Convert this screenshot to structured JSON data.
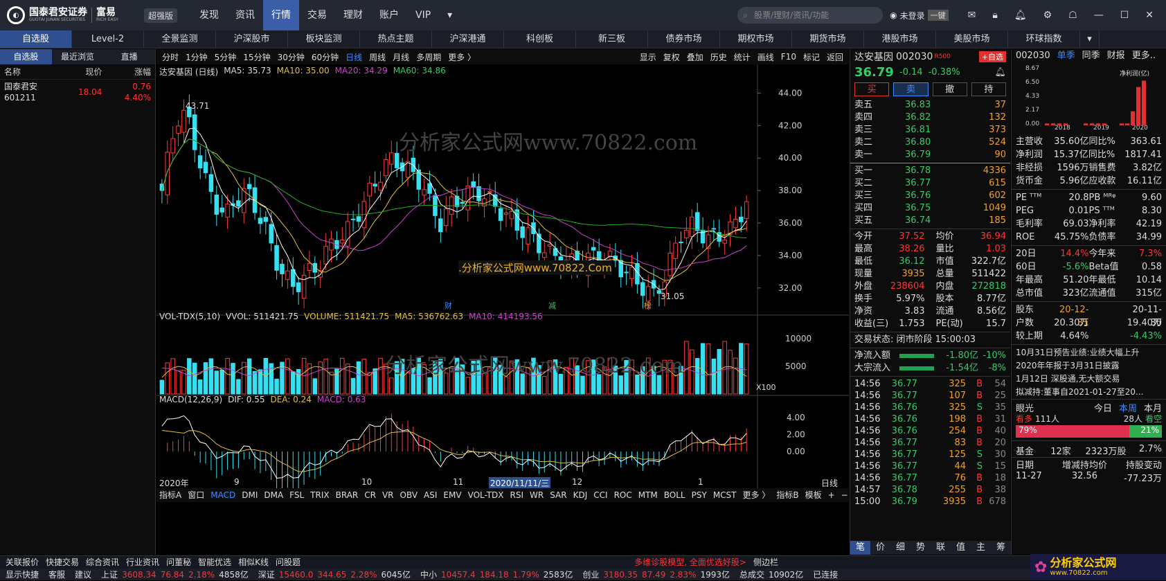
{
  "app": {
    "logo_text": "国泰君安证券",
    "logo_sub": "GUOTAI JUNAN SECURITIES",
    "brand": "富易",
    "brand_sub": "RICH EASY",
    "version": "超强版"
  },
  "nav": {
    "items": [
      "发现",
      "资讯",
      "行情",
      "交易",
      "理财",
      "账户",
      "VIP"
    ],
    "active": "行情",
    "search_placeholder": "股票/理财/资讯/功能",
    "login": "未登录",
    "theme": "一键"
  },
  "tabs": [
    "自选股",
    "Level-2",
    "全景监测",
    "沪深股市",
    "板块监测",
    "热点主题",
    "沪深港通",
    "科创板",
    "新三板",
    "债券市场",
    "期权市场",
    "期货市场",
    "港股市场",
    "美股市场",
    "环球指数"
  ],
  "left": {
    "tabs": [
      "自选股",
      "最近浏览",
      "直播"
    ],
    "cols": [
      "名称",
      "现价",
      "涨幅"
    ],
    "rows": [
      {
        "name": "国泰君安",
        "code": "601211",
        "price": "18.04",
        "chg": "0.76",
        "pct": "4.40%"
      }
    ]
  },
  "chart": {
    "periods": [
      "分时",
      "1分钟",
      "5分钟",
      "15分钟",
      "30分钟",
      "60分钟",
      "日线",
      "周线",
      "月线",
      "多周期",
      "更多 〉"
    ],
    "active_period": "日线",
    "tools": [
      "显示",
      "复权",
      "叠加",
      "历史",
      "统计",
      "画线",
      "F10",
      "标记",
      "返回"
    ],
    "title": "达安基因 (日线)",
    "ma5": "MA5: 35.73",
    "ma10": "MA10: 35.00",
    "ma20": "MA20: 34.29",
    "ma60": "MA60: 34.86",
    "high_label": "43.71",
    "low_label": "31.05",
    "vol_title": "VOL-TDX(5,10)",
    "vvol": "VVOL: 511421.75",
    "volume": "VOLUME: 511421.75",
    "vma5": "MA5: 536762.63",
    "vma10": "MA10: 414193.56",
    "vol_unit": "X100",
    "macd_title": "MACD(12,26,9)",
    "dif": "DIF: 0.55",
    "dea": "DEA: 0.24",
    "macd": "MACD: 0.63",
    "date_labels": [
      "2020年",
      "9",
      "10",
      "11",
      "2020/11/11/三",
      "12",
      "1",
      "日线"
    ],
    "markers": [
      "财",
      "减",
      "榜"
    ],
    "bottom_tabs": [
      "指标A",
      "窗口",
      "MACD",
      "DMI",
      "DMA",
      "FSL",
      "TRIX",
      "BRAR",
      "CR",
      "VR",
      "OBV",
      "ASI",
      "EMV",
      "VOL-TDX",
      "RSI",
      "WR",
      "SAR",
      "KDJ",
      "CCI",
      "ROC",
      "MTM",
      "BOLL",
      "PSY",
      "MCST",
      "更多 〉",
      "指标B",
      "模板",
      "+",
      "−"
    ],
    "watermark1": "分析家公式网www.70822.com",
    "watermark2": ".分析家公式网www.70822.Com"
  },
  "chart_data": {
    "type": "candlestick",
    "price_ticks": [
      44,
      42,
      40,
      38,
      36,
      34,
      32
    ],
    "vol_ticks": [
      10000,
      5000
    ],
    "macd_ticks": [
      4,
      2,
      0
    ],
    "close_series": [
      38,
      41,
      43,
      42,
      40,
      38,
      37,
      36.5,
      37.5,
      38,
      37,
      36,
      34,
      33,
      32,
      32.5,
      33,
      33.5,
      34.5,
      35,
      35.5,
      36.5,
      37.5,
      38.5,
      39.5,
      40,
      39.5,
      39,
      38.5,
      37,
      36,
      37,
      37.5,
      37.8,
      38,
      37.5,
      37,
      36.5,
      36,
      35.5,
      35,
      34.5,
      34,
      33.8,
      33.5,
      33.6,
      33.8,
      34,
      33.8,
      33.5,
      33,
      32.5,
      32,
      31.5,
      32.5,
      34,
      35.5,
      35.8,
      35.5,
      35,
      35.2,
      35.5,
      36,
      37.5
    ]
  },
  "quote": {
    "name": "达安基因",
    "code": "002030",
    "tag": "R500",
    "add": "+自选",
    "price": "36.79",
    "chg": "-0.14",
    "pct": "-0.38%",
    "actions": [
      "买",
      "卖",
      "撤",
      "持"
    ],
    "asks": [
      {
        "l": "卖五",
        "p": "36.83",
        "v": "37"
      },
      {
        "l": "卖四",
        "p": "36.82",
        "v": "132"
      },
      {
        "l": "卖三",
        "p": "36.81",
        "v": "373"
      },
      {
        "l": "卖二",
        "p": "36.80",
        "v": "524"
      },
      {
        "l": "卖一",
        "p": "36.79",
        "v": "90"
      }
    ],
    "bids": [
      {
        "l": "买一",
        "p": "36.78",
        "v": "4336"
      },
      {
        "l": "买二",
        "p": "36.77",
        "v": "615"
      },
      {
        "l": "买三",
        "p": "36.76",
        "v": "602"
      },
      {
        "l": "买四",
        "p": "36.75",
        "v": "1049"
      },
      {
        "l": "买五",
        "p": "36.74",
        "v": "185"
      }
    ],
    "stats": [
      [
        "今开",
        "37.52",
        "均价",
        "36.94"
      ],
      [
        "最高",
        "38.26",
        "量比",
        "1.03"
      ],
      [
        "最低",
        "36.12",
        "市值",
        "322.7亿"
      ],
      [
        "现量",
        "3935",
        "总量",
        "511422"
      ],
      [
        "外盘",
        "238604",
        "内盘",
        "272818"
      ],
      [
        "换手",
        "5.97%",
        "股本",
        "8.77亿"
      ],
      [
        "净资",
        "3.83",
        "流通",
        "8.56亿"
      ],
      [
        "收益(三)",
        "1.753",
        "PE(动)",
        "15.7"
      ]
    ],
    "status": "交易状态: 闭市阶段 15:00:03",
    "flows": [
      [
        "净流入额",
        "-1.80亿",
        "-10%"
      ],
      [
        "大宗流入",
        "-1.54亿",
        "-8%"
      ]
    ],
    "ticks": [
      [
        "14:56",
        "36.77",
        "325",
        "B",
        "54"
      ],
      [
        "14:56",
        "36.77",
        "107",
        "B",
        "25"
      ],
      [
        "14:56",
        "36.76",
        "325",
        "S",
        "35"
      ],
      [
        "14:56",
        "36.76",
        "198",
        "B",
        "31"
      ],
      [
        "14:56",
        "36.76",
        "254",
        "B",
        "40"
      ],
      [
        "14:56",
        "36.77",
        "83",
        "B",
        "20"
      ],
      [
        "14:56",
        "36.77",
        "125",
        "S",
        "30"
      ],
      [
        "14:56",
        "36.77",
        "44",
        "S",
        "15"
      ],
      [
        "14:56",
        "36.77",
        "76",
        "B",
        "18"
      ],
      [
        "14:57",
        "36.78",
        "255",
        "B",
        "38"
      ],
      [
        "15:00",
        "36.79",
        "3935",
        "B",
        "678"
      ]
    ],
    "bottom_tabs": [
      "笔",
      "价",
      "细",
      "势",
      "联",
      "值",
      "主",
      "筹"
    ]
  },
  "f10": {
    "code": "002030",
    "tabs": [
      "单季",
      "同季",
      "财报",
      "更多.."
    ],
    "chart_label": "净利润(亿)",
    "y_ticks": [
      "8.67",
      "6.50",
      "4.33",
      "2.17",
      "0.00"
    ],
    "x_ticks": [
      "2018",
      "2019",
      "2020"
    ],
    "rows": [
      [
        "主营收",
        "35.60亿",
        "同比%",
        "363.61"
      ],
      [
        "净利润",
        "15.37亿",
        "同比%",
        "1817.41"
      ],
      [
        "非经损",
        "1596万",
        "销售费",
        "3.82亿"
      ],
      [
        "货币金",
        "5.96亿",
        "应收款",
        "16.11亿"
      ]
    ],
    "rows2": [
      [
        "PE ᵀᵀᴹ",
        "20.8",
        "PB ᴹᴿᵠ",
        "9.60"
      ],
      [
        "PEG",
        "0.01",
        "PS ᵀᵀᴹ",
        "8.30"
      ],
      [
        "毛利率",
        "69.03",
        "净利率",
        "42.19"
      ],
      [
        "ROE",
        "45.75%",
        "负债率",
        "34.99"
      ]
    ],
    "rows3": [
      [
        "20日",
        "14.4%",
        "今年来",
        "7.3%"
      ],
      [
        "60日",
        "-5.6%",
        "Beta值",
        "0.58"
      ],
      [
        "年最高",
        "51.20",
        "年最低",
        "10.14"
      ],
      [
        "总市值",
        "323亿",
        "流通值",
        "315亿"
      ]
    ],
    "rows4": [
      [
        "股东",
        "20-12-31",
        "",
        "20-11-30"
      ],
      [
        "户数",
        "20.30万",
        "",
        "19.40万"
      ],
      [
        "较上期",
        "4.64%",
        "",
        "-4.43%"
      ]
    ],
    "news": [
      "10月31日预告业绩:业绩大幅上升",
      "2020年年报于3月31日披露",
      "1月12日 深股通,无大额交易",
      "拟减持:董事自2021-01-27至20..."
    ],
    "eye": "眼光",
    "eye_tabs": [
      "今日",
      "本周",
      "本月"
    ],
    "bull": "看多",
    "bull_n": "111人",
    "bear_n": "28人",
    "bear": "看空",
    "bull_pct": "79%",
    "bear_pct": "21%",
    "fund": [
      "基金",
      "12家",
      "2323万股",
      "2.7%"
    ],
    "hold_head": [
      "日期",
      "增减持均价",
      "持股变动"
    ],
    "hold_row": [
      "11-27",
      "32.56",
      "-77.23万"
    ]
  },
  "status": {
    "row1": [
      "显示快捷",
      "客服",
      "建议"
    ],
    "indices": [
      [
        "上证",
        "3608.34",
        "76.84",
        "2.18%",
        "4858亿"
      ],
      [
        "深证",
        "15460.0",
        "344.65",
        "2.28%",
        "6045亿"
      ],
      [
        "中小",
        "10457.4",
        "184.18",
        "1.79%",
        "2583亿"
      ],
      [
        "创业",
        "3180.35",
        "87.49",
        "2.83%",
        "1993亿"
      ]
    ],
    "total": "总成交",
    "total_v": "10902亿",
    "conn": "已连接",
    "bottom": [
      "关联报价",
      "快捷交易",
      "综合资讯",
      "行业资讯",
      "问董秘",
      "智能优选",
      "相似K线",
      "问股题"
    ],
    "promo": "多维诊股模型, 全面优选好股>",
    "side": "侧边栏"
  },
  "corner_logo": "分析家公式网",
  "corner_url": "www.70822.com"
}
